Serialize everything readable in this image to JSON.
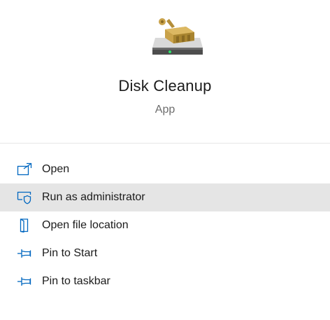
{
  "app": {
    "name": "Disk Cleanup",
    "type": "App",
    "icon": "disk-cleanup-icon"
  },
  "menu": {
    "hovered_index": 1,
    "items": [
      {
        "label": "Open",
        "icon": "open-icon"
      },
      {
        "label": "Run as administrator",
        "icon": "admin-shield-icon"
      },
      {
        "label": "Open file location",
        "icon": "file-location-icon"
      },
      {
        "label": "Pin to Start",
        "icon": "pin-icon"
      },
      {
        "label": "Pin to taskbar",
        "icon": "pin-icon"
      }
    ]
  },
  "colors": {
    "accent": "#0078d4",
    "hover_background": "#e5e5e5",
    "secondary_text": "#6d6d6d"
  }
}
